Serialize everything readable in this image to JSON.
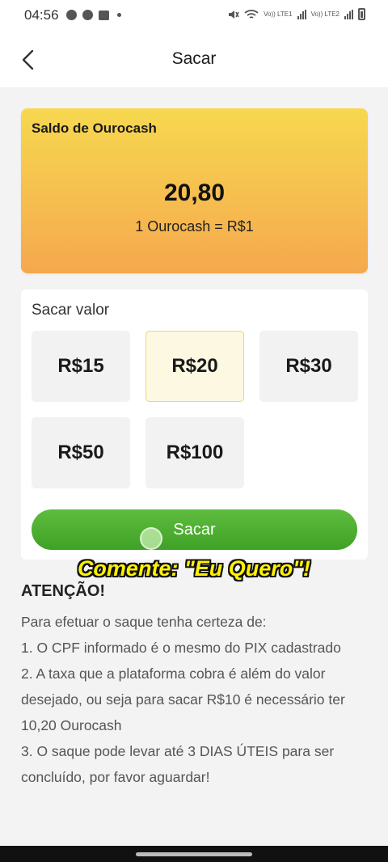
{
  "status_bar": {
    "time": "04:56",
    "network_label_1": "Vo)) LTE1",
    "network_label_2": "Vo)) LTE2"
  },
  "header": {
    "title": "Sacar",
    "back_icon": "chevron-left-icon"
  },
  "balance_card": {
    "label": "Saldo de Ourocash",
    "amount": "20,80",
    "rate": "1 Ourocash = R$1"
  },
  "withdraw": {
    "label": "Sacar valor",
    "options": [
      "R$15",
      "R$20",
      "R$30",
      "R$50",
      "R$100"
    ],
    "selected": "R$20",
    "button_label": "Sacar"
  },
  "overlay_caption": "Comente: \"Eu Quero\"!",
  "notice": {
    "title": "ATENÇÃO!",
    "lines": [
      "Para efetuar o saque tenha certeza de:",
      "1. O CPF informado é o mesmo do PIX cadastrado",
      "2. A taxa que a plataforma cobra é além do valor desejado, ou seja para sacar R$10 é necessário ter 10,20 Ourocash",
      "3. O saque pode levar até 3 DIAS ÚTEIS para ser concluído, por favor aguardar!"
    ]
  },
  "colors": {
    "card_gradient_top": "#f7d84f",
    "card_gradient_bottom": "#f5a84e",
    "button_green": "#4caf30",
    "selected_border": "#ecd86c",
    "caption_yellow": "#fff200"
  }
}
